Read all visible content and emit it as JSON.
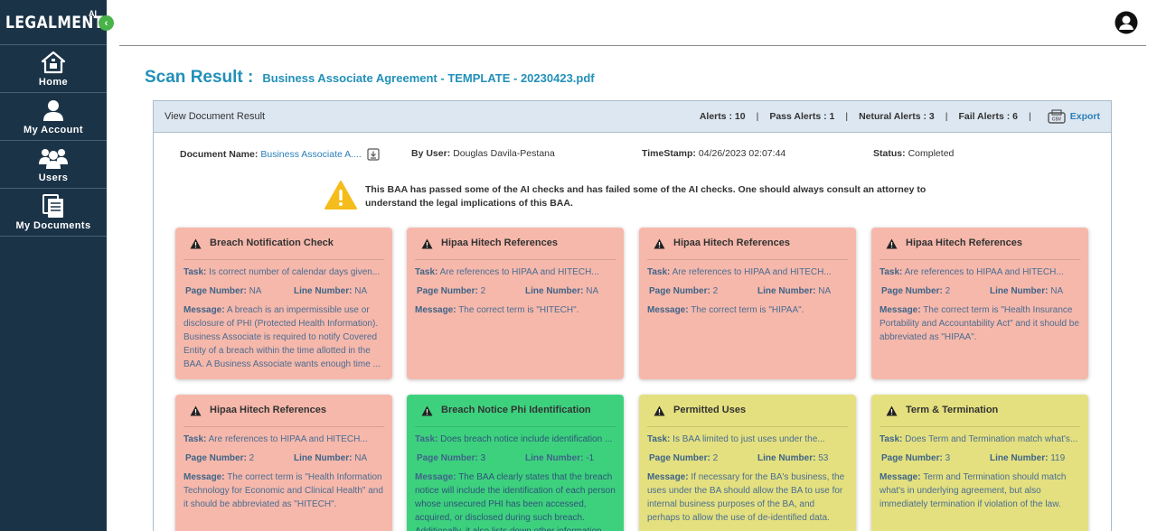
{
  "brand": {
    "name": "LEGALMENTE",
    "sup": "AI"
  },
  "sidebar": {
    "items": [
      {
        "label": "Home",
        "icon": "home-icon"
      },
      {
        "label": "My Account",
        "icon": "account-icon"
      },
      {
        "label": "Users",
        "icon": "users-icon"
      },
      {
        "label": "My Documents",
        "icon": "documents-icon"
      }
    ]
  },
  "page": {
    "title": "Scan Result :",
    "file_name": "Business Associate Agreement - TEMPLATE - 20230423.pdf"
  },
  "panel": {
    "title": "View Document Result",
    "alerts": "Alerts : 10",
    "pass_alerts": "Pass Alerts : 1",
    "neutral_alerts": "Netural Alerts : 3",
    "fail_alerts": "Fail Alerts : 6",
    "separator": "|",
    "export_label": "Export"
  },
  "document": {
    "name_label": "Document Name:",
    "name_value": "Business Associate A....",
    "user_label": "By User:",
    "user_value": "Douglas Davila-Pestana",
    "time_label": "TimeStamp:",
    "time_value": "04/26/2023 02:07:44",
    "status_label": "Status:",
    "status_value": "Completed"
  },
  "warning_text": "This BAA has passed some of the AI checks and has failed some of the AI checks. One should always consult an attorney to understand the legal implications of this BAA.",
  "labels": {
    "task": "Task:",
    "page_number": "Page Number:",
    "line_number": "Line Number:",
    "message": "Message:"
  },
  "colors": {
    "fail": "#f6b8ab",
    "pass": "#3dd17e",
    "neutral": "#e4e07f",
    "sidebar": "#1b3347",
    "accent": "#2290b8"
  },
  "cards": [
    {
      "status": "fail",
      "title": "Breach Notification Check",
      "task": "Is correct number of calendar days given...",
      "page": "NA",
      "line": "NA",
      "message": "A breach is an impermissible use or disclosure of PHI (Protected Health Information). Business Associate is required to notify Covered Entity of a breach within the time allotted in the BAA. A Business Associate wants enough time ..."
    },
    {
      "status": "fail",
      "title": "Hipaa Hitech References",
      "task": "Are references to HIPAA and HITECH...",
      "page": "2",
      "line": "NA",
      "message": "The correct term is \"HITECH\"."
    },
    {
      "status": "fail",
      "title": "Hipaa Hitech References",
      "task": "Are references to HIPAA and HITECH...",
      "page": "2",
      "line": "NA",
      "message": "The correct term is \"HIPAA\"."
    },
    {
      "status": "fail",
      "title": "Hipaa Hitech References",
      "task": "Are references to HIPAA and HITECH...",
      "page": "2",
      "line": "NA",
      "message": "The correct term is \"Health Insurance Portability and Accountability Act\" and it should be abbreviated as \"HIPAA\"."
    },
    {
      "status": "fail",
      "title": "Hipaa Hitech References",
      "task": "Are references to HIPAA and HITECH...",
      "page": "2",
      "line": "NA",
      "message": "The correct term is \"Health Information Technology for Economic and Clinical Health\" and it should be abbreviated as \"HITECH\"."
    },
    {
      "status": "pass",
      "title": "Breach Notice Phi Identification",
      "task": "Does breach notice include identification ...",
      "page": "3",
      "line": "-1",
      "message": "The BAA clearly states that the breach notice will include the identification of each person whose unsecured PHI has been accessed, acquired, or disclosed during such breach. Additionally, it also lists down other information"
    },
    {
      "status": "neutral",
      "title": "Permitted Uses",
      "task": "Is BAA limited to just uses under the...",
      "page": "2",
      "line": "53",
      "message": "If necessary for the BA's business, the uses under the BA should allow the BA to use for internal business purposes of the BA, and perhaps to allow the use of de-identified data."
    },
    {
      "status": "neutral",
      "title": "Term & Termination",
      "task": "Does Term and Termination match what's...",
      "page": "3",
      "line": "119",
      "message": "Term and Termination should match what's in underlying agreement, but also immediately termination if violation of the law."
    }
  ]
}
